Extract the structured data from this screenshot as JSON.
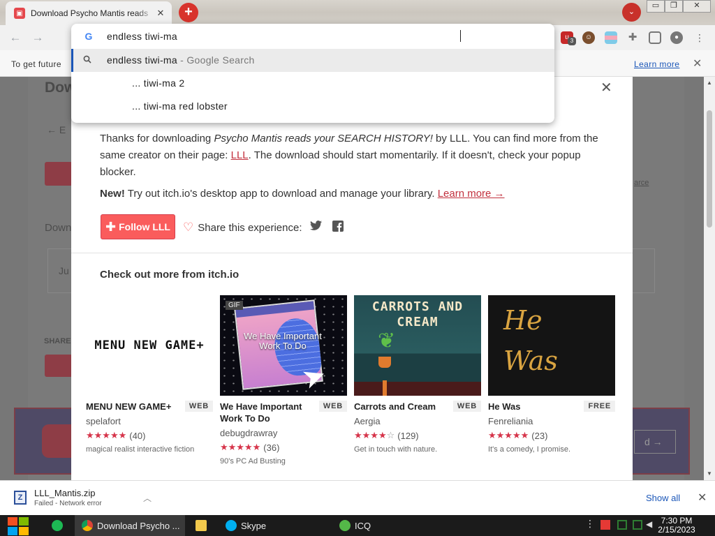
{
  "browser": {
    "tab_title": "Download Psycho Mantis reads",
    "tab_close": "✕",
    "new_tab": "+",
    "window_min": "▭",
    "window_max": "❐",
    "window_close": "✕",
    "extension_badge": "3"
  },
  "omnibox": {
    "input_value": "endless tiwi-ma",
    "suggestions": [
      {
        "prefix": "endless tiwi-ma",
        "suffix": " - Google Search"
      },
      {
        "prefix": "... tiwi-ma",
        "suffix": " 2"
      },
      {
        "prefix": "... tiwi-ma",
        "suffix": " red lobster"
      }
    ]
  },
  "infobar": {
    "text": "To get future",
    "link": "Learn more"
  },
  "background_page": {
    "title": "Dow",
    "back_link": "← E",
    "download_label": "Down",
    "box_text": "Ju",
    "share_label": "SHARE",
    "right_link": "arce",
    "next_label": "d →"
  },
  "modal": {
    "close": "✕",
    "thanks_pre": "Thanks for downloading ",
    "game_title": "Psycho Mantis reads your SEARCH HISTORY!",
    "thanks_mid": " by LLL. You can find more from the same creator on their page: ",
    "creator_link": "LLL",
    "thanks_post": ". The download should start momentarily. If it doesn't, check your popup blocker.",
    "new_label": "New!",
    "new_text": " Try out itch.io's desktop app to download and manage your library. ",
    "learn_more": "Learn more →",
    "follow_button": "Follow LLL",
    "share_text": "Share this experience:",
    "rec_heading": "Check out more from itch.io"
  },
  "games": [
    {
      "thumb_text": "MENU NEW GAME+",
      "title": "MENU NEW GAME+",
      "badge": "WEB",
      "author": "spelafort",
      "stars": "★★★★★",
      "rating_count": "(40)",
      "desc": "magical realist interactive fiction"
    },
    {
      "thumb_text": "We Have Important Work To Do",
      "thumb_tag": "GIF",
      "title": "We Have Important Work To Do",
      "badge": "WEB",
      "author": "debugdrawray",
      "stars": "★★★★★",
      "rating_count": "(36)",
      "desc": "90's PC Ad Busting"
    },
    {
      "thumb_text": "CARROTS AND CREAM",
      "title": "Carrots and Cream",
      "badge": "WEB",
      "author": "Aergia",
      "stars_on": "★★★★",
      "stars_off": "☆",
      "rating_count": "(129)",
      "desc": "Get in touch with nature."
    },
    {
      "thumb_text_1": "He",
      "thumb_text_2": "Was",
      "title": "He Was",
      "badge": "FREE",
      "author": "Fenreliania",
      "stars": "★★★★★",
      "rating_count": "(23)",
      "desc": "It's a comedy, I promise."
    }
  ],
  "download_shelf": {
    "file_name": "LLL_Mantis.zip",
    "status": "Failed - Network error",
    "show_all": "Show all",
    "close": "✕"
  },
  "taskbar": {
    "items": [
      "Download Psycho ...",
      "Skype",
      "ICQ"
    ],
    "time": "7:30 PM",
    "date": "2/15/2023"
  },
  "colors": {
    "itch_red": "#fa5c5c",
    "link_red": "#c2303d",
    "chrome_blue": "#1a56b8"
  }
}
